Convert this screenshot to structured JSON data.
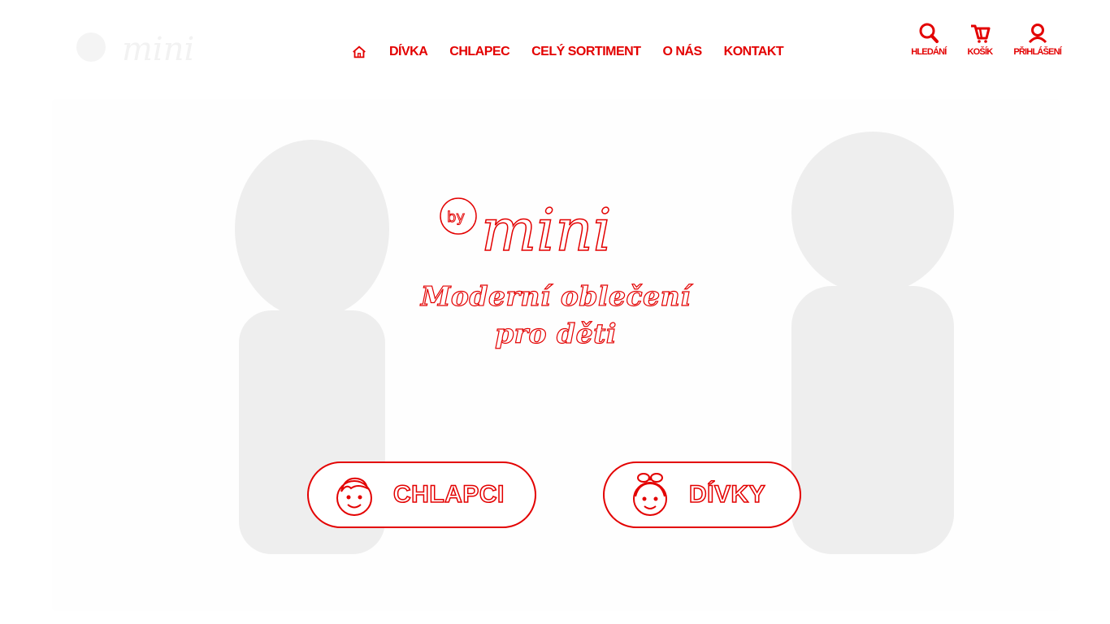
{
  "brand": {
    "logo_text": "mini",
    "logo_prefix": "by",
    "accent_color": "#e30000"
  },
  "nav": {
    "home_icon": "home-icon",
    "items": [
      {
        "label": "DÍVKA"
      },
      {
        "label": "CHLAPEC"
      },
      {
        "label": "CELÝ SORTIMENT"
      },
      {
        "label": "O NÁS"
      },
      {
        "label": "KONTAKT"
      }
    ]
  },
  "tools": {
    "search": {
      "label": "HLEDÁNÍ",
      "icon": "search-icon"
    },
    "cart": {
      "label": "KOŠÍK",
      "icon": "cart-icon"
    },
    "login": {
      "label": "PŘIHLÁŠENÍ",
      "icon": "user-icon"
    }
  },
  "hero": {
    "tagline_line1": "Moderní oblečení",
    "tagline_line2": "pro děti",
    "boys_button": {
      "label": "CHLAPCI",
      "icon": "boy-face-icon"
    },
    "girls_button": {
      "label": "DÍVKY",
      "icon": "girl-face-icon"
    }
  }
}
